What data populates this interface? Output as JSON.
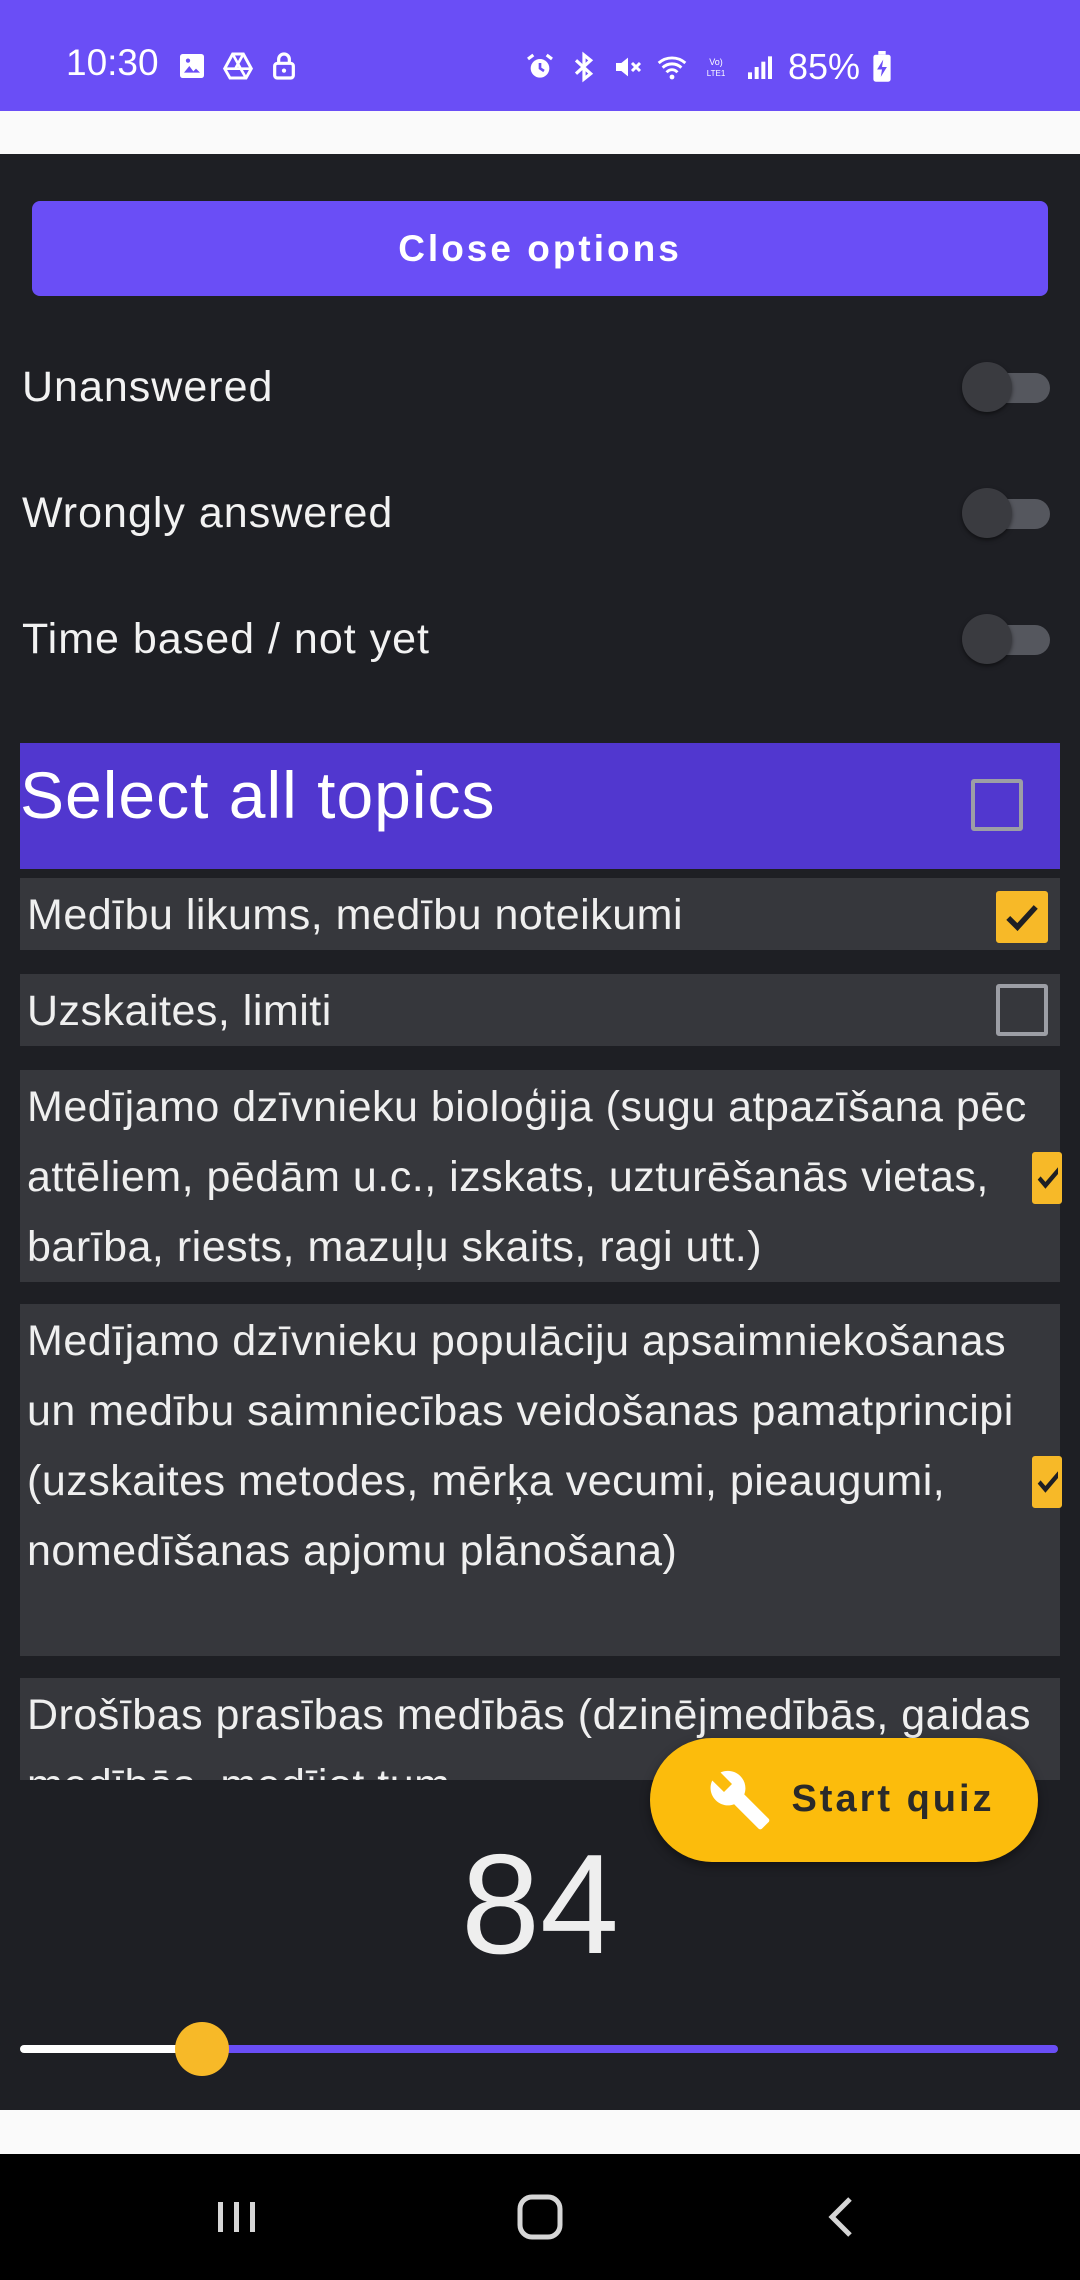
{
  "status_bar": {
    "time": "10:30",
    "battery": "85%",
    "accent_color": "#6a4ef6",
    "left_icons": [
      "image-icon",
      "drive-icon",
      "lock-icon"
    ],
    "right_icons": [
      "alarm-icon",
      "bluetooth-icon",
      "mute-icon",
      "wifi-icon",
      "volte-icon",
      "signal-icon",
      "battery-charging-icon"
    ]
  },
  "options": {
    "close_label": "Close options",
    "toggles": [
      {
        "label": "Unanswered",
        "on": false
      },
      {
        "label": "Wrongly answered",
        "on": false
      },
      {
        "label": "Time based / not yet",
        "on": false
      }
    ]
  },
  "topics": {
    "select_all_label": "Select all topics",
    "select_all_checked": false,
    "items": [
      {
        "label": "Medību likums, medību noteikumi",
        "checked": true
      },
      {
        "label": "Uzskaites, limiti",
        "checked": false
      },
      {
        "label": "Medījamo dzīvnieku bioloģija (sugu atpazīšana pēc attēliem, pēdām u.c., izskats, uzturēšanās vietas, barība, riests, mazuļu skaits, ragi utt.)",
        "checked": true
      },
      {
        "label": "Medījamo dzīvnieku populāciju apsaimniekošanas un medību saimniecības veidošanas pamatprincipi (uzskaites metodes, mērķa vecumi, pieaugumi,  nomedīšanas apjomu plānošana)",
        "checked": true
      },
      {
        "label": "Drošības prasības medībās (dzinējmedībās, gaidas medībās, medījot tum",
        "checked": true
      }
    ]
  },
  "counter": {
    "value": "84"
  },
  "slider": {
    "fraction": 0.17
  },
  "fab": {
    "label": "Start quiz",
    "icon": "wrench-icon",
    "color": "#fcbc0c"
  },
  "nav_bar": {
    "icons": [
      "recent-apps-icon",
      "home-icon",
      "back-icon"
    ]
  }
}
